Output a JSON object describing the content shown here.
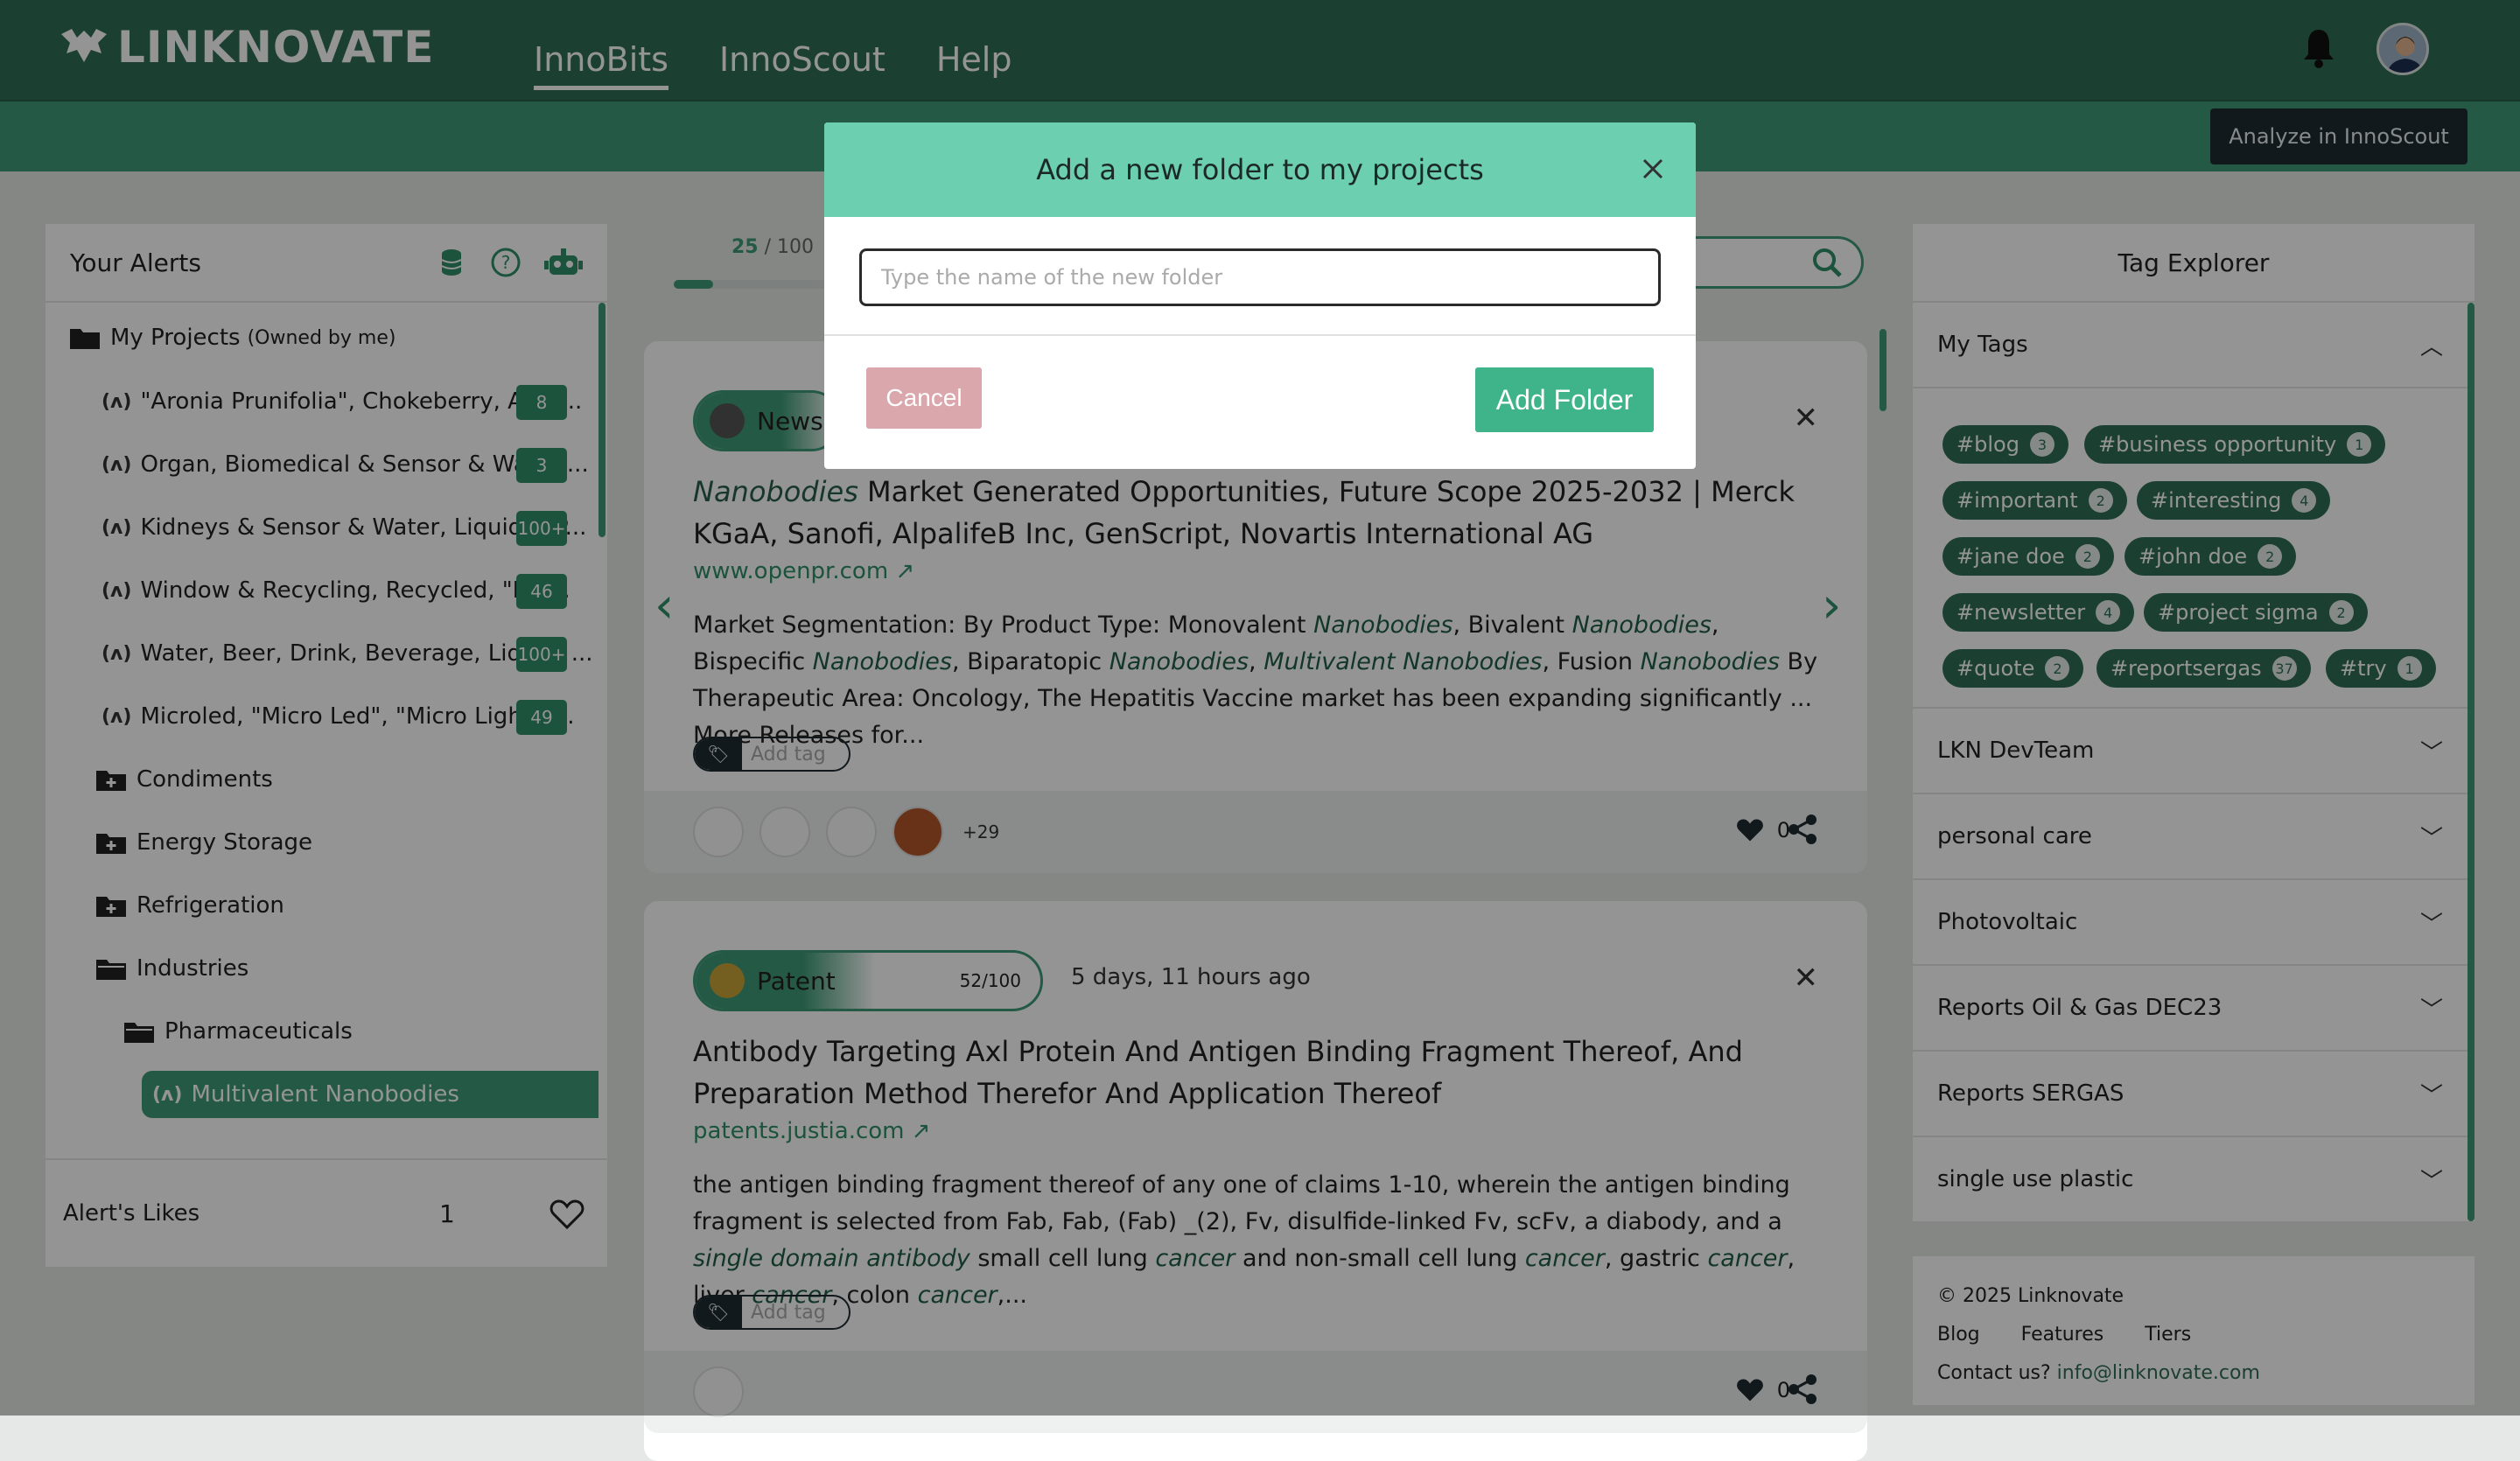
{
  "brand": "LINKNOVATE",
  "nav": {
    "tabs": [
      {
        "label": "InnoBits"
      },
      {
        "label": "InnoScout"
      },
      {
        "label": "Help"
      }
    ]
  },
  "toolbar": {
    "analyze_label": "Analyze in InnoScout"
  },
  "alerts": {
    "title": "Your Alerts",
    "my_projects": "My Projects",
    "owned": "(Owned by me)",
    "items": [
      {
        "label": "\"Aronia Prunifolia\", Chokeberry, Aron...",
        "count": "8"
      },
      {
        "label": "Organ, Biomedical & Sensor & Water,...",
        "count": "3"
      },
      {
        "label": "Kidneys & Sensor & Water, Liquid & P...",
        "count": "100+"
      },
      {
        "label": "Window & Recycling, Recycled, \"Re ...",
        "count": "46"
      },
      {
        "label": "Water, Beer, Drink, Beverage, Liquid, ...",
        "count": "100+"
      },
      {
        "label": "Microled, \"Micro Led\", \"Micro Light E...",
        "count": "49"
      }
    ],
    "folders": [
      "Condiments",
      "Energy Storage",
      "Refrigeration",
      "Industries",
      "Pharmaceuticals"
    ],
    "selected": "Multivalent Nanobodies",
    "likes_label": "Alert's Likes",
    "likes_count": "1"
  },
  "progress": {
    "value": "25",
    "max": "/ 100",
    "fraction": 0.25
  },
  "cards": [
    {
      "type": "News",
      "title_em": "Nanobodies",
      "title_rest": " Market Generated Opportunities, Future Scope 2025-2032 | Merck KGaA, Sanofi, AlpalifeB Inc, GenScript, Novartis International AG",
      "url": "www.openpr.com",
      "body_html_parts": [
        "Market Segmentation: By Product Type: Monovalent ",
        "Nanobodies",
        ", Bivalent ",
        "Nanobodies",
        ", Bispecific ",
        "Nanobodies",
        ", Biparatopic ",
        "Nanobodies",
        ", ",
        "Multivalent Nanobodies",
        ", Fusion ",
        "Nanobodies",
        " By Therapeutic Area: Oncology, The Hepatitis Vaccine market has been expanding significantly ... More Releases for..."
      ],
      "tag_placeholder": "Add tag",
      "more": "+29",
      "likes": "0"
    },
    {
      "type": "Patent",
      "score": "52/100",
      "score_fraction": 0.52,
      "time": "5 days, 11 hours ago",
      "title": "Antibody Targeting Axl Protein And Antigen Binding Fragment Thereof, And Preparation Method Therefor And Application Thereof",
      "url": "patents.justia.com",
      "body_html_parts": [
        "the antigen binding fragment thereof of any one of claims 1-10, wherein the antigen binding fragment is selected from Fab, Fab, (Fab) _(2), Fv, disulfide-linked Fv, scFv, a diabody, and a ",
        "single domain antibody",
        " small cell lung ",
        "cancer",
        " and non-small cell lung ",
        "cancer",
        ", gastric ",
        "cancer",
        ", liver ",
        "cancer",
        ", colon ",
        "cancer",
        ",..."
      ],
      "tag_placeholder": "Add tag",
      "likes": "0"
    }
  ],
  "tag_explorer": {
    "title": "Tag Explorer",
    "my_tags": "My Tags",
    "tags": [
      {
        "name": "#blog",
        "n": "3"
      },
      {
        "name": "#business opportunity",
        "n": "1"
      },
      {
        "name": "#important",
        "n": "2"
      },
      {
        "name": "#interesting",
        "n": "4"
      },
      {
        "name": "#jane doe",
        "n": "2"
      },
      {
        "name": "#john doe",
        "n": "2"
      },
      {
        "name": "#newsletter",
        "n": "4"
      },
      {
        "name": "#project sigma",
        "n": "2"
      },
      {
        "name": "#quote",
        "n": "2"
      },
      {
        "name": "#reportsergas",
        "n": "37"
      },
      {
        "name": "#try",
        "n": "1"
      }
    ],
    "groups": [
      "LKN DevTeam",
      "personal care",
      "Photovoltaic",
      "Reports Oil & Gas DEC23",
      "Reports SERGAS",
      "single use plastic"
    ]
  },
  "footer": {
    "copyright": "© 2025 Linknovate",
    "links": [
      "Blog",
      "Features",
      "Tiers"
    ],
    "contact_label": "Contact us?",
    "email": "info@linknovate.com"
  },
  "modal": {
    "title": "Add a new folder to my projects",
    "placeholder": "Type the name of the new folder",
    "cancel": "Cancel",
    "add": "Add Folder"
  }
}
